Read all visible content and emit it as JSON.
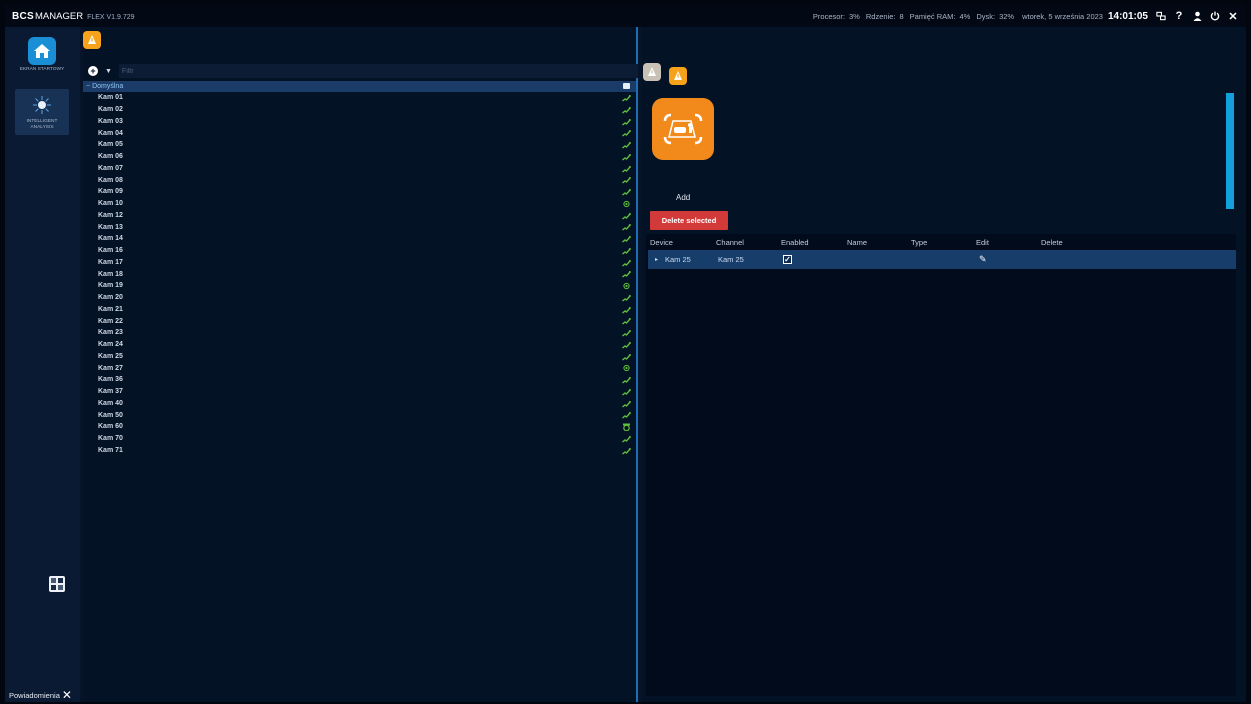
{
  "topbar": {
    "brand_logo": "BCS",
    "brand_name": "MANAGER",
    "version": "FLEX V1.9.729",
    "stats": [
      {
        "label": "Procesor:",
        "value": "3%"
      },
      {
        "label": "Rdzenie:",
        "value": "8"
      },
      {
        "label": "Pamięć RAM:",
        "value": "4%"
      },
      {
        "label": "Dysk:",
        "value": "32%"
      }
    ],
    "date": "wtorek, 5 września 2023",
    "time": "14:01:05",
    "icons": [
      "network-icon",
      "help-icon",
      "user-icon",
      "power-icon",
      "close-icon"
    ]
  },
  "nav": {
    "home_label": "EKRAN STARTOWY",
    "ia_label": "INTELLIGENT ANALYSIS",
    "notifications_label": "Powiadomienia"
  },
  "tree": {
    "filter_placeholder": "Filtr",
    "root_label": "Domyślna",
    "items": [
      {
        "label": "Kam 01",
        "status": "online"
      },
      {
        "label": "Kam 02",
        "status": "online"
      },
      {
        "label": "Kam 03",
        "status": "online"
      },
      {
        "label": "Kam 04",
        "status": "online"
      },
      {
        "label": "Kam 05",
        "status": "online"
      },
      {
        "label": "Kam 06",
        "status": "online"
      },
      {
        "label": "Kam 07",
        "status": "online"
      },
      {
        "label": "Kam 08",
        "status": "online"
      },
      {
        "label": "Kam 09",
        "status": "online"
      },
      {
        "label": "Kam 10",
        "status": "sensor"
      },
      {
        "label": "Kam 12",
        "status": "online"
      },
      {
        "label": "Kam 13",
        "status": "online"
      },
      {
        "label": "Kam 14",
        "status": "online"
      },
      {
        "label": "Kam 16",
        "status": "online"
      },
      {
        "label": "Kam 17",
        "status": "online"
      },
      {
        "label": "Kam 18",
        "status": "online"
      },
      {
        "label": "Kam 19",
        "status": "sensor"
      },
      {
        "label": "Kam 20",
        "status": "online"
      },
      {
        "label": "Kam 21",
        "status": "online"
      },
      {
        "label": "Kam 22",
        "status": "online"
      },
      {
        "label": "Kam 23",
        "status": "online"
      },
      {
        "label": "Kam 24",
        "status": "online"
      },
      {
        "label": "Kam 25",
        "status": "online"
      },
      {
        "label": "Kam 27",
        "status": "sensor"
      },
      {
        "label": "Kam 36",
        "status": "online"
      },
      {
        "label": "Kam 37",
        "status": "online"
      },
      {
        "label": "Kam 40",
        "status": "online"
      },
      {
        "label": "Kam 50",
        "status": "online"
      },
      {
        "label": "Kam 60",
        "status": "dome"
      },
      {
        "label": "Kam 70",
        "status": "online"
      },
      {
        "label": "Kam 71",
        "status": "online"
      }
    ]
  },
  "right": {
    "add_label": "Add",
    "delete_selected_label": "Delete selected",
    "columns": [
      "Device",
      "Channel",
      "Enabled",
      "Name",
      "Type",
      "Edit",
      "Delete"
    ],
    "rows": [
      {
        "device": "Kam 25",
        "channel": "Kam 25",
        "enabled": true,
        "name": "",
        "type": ""
      }
    ]
  },
  "colors": {
    "accent_orange": "#f7a21b",
    "accent_blue": "#1b8fd6",
    "status_green": "#5fbf3a",
    "delete_red": "#d23a3a"
  }
}
